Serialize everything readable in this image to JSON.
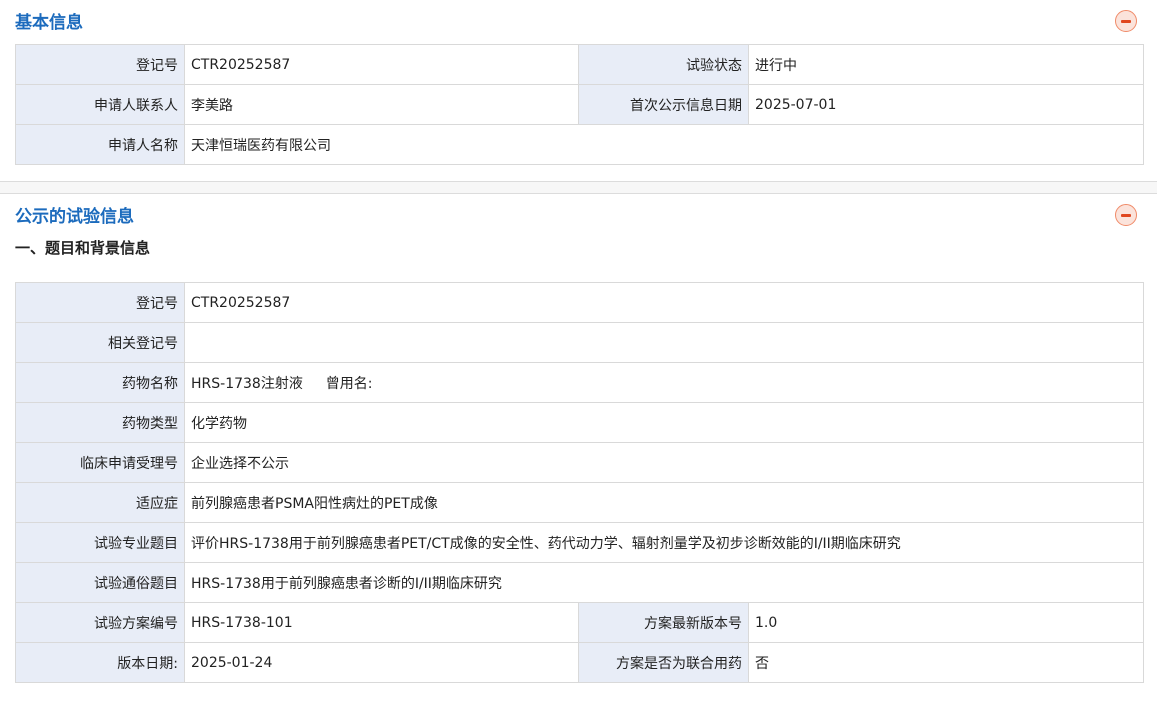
{
  "basic": {
    "title": "基本信息",
    "reg_no_label": "登记号",
    "reg_no": "CTR20252587",
    "status_label": "试验状态",
    "status": "进行中",
    "contact_label": "申请人联系人",
    "contact": "李美路",
    "first_pub_label": "首次公示信息日期",
    "first_pub": "2025-07-01",
    "applicant_label": "申请人名称",
    "applicant": "天津恒瑞医药有限公司"
  },
  "public": {
    "title": "公示的试验信息",
    "subhead": "一、题目和背景信息",
    "rows": {
      "reg_no_label": "登记号",
      "reg_no": "CTR20252587",
      "related_label": "相关登记号",
      "related": "",
      "drug_label": "药物名称",
      "drug": "HRS-1738注射液　  曾用名:",
      "drug_type_label": "药物类型",
      "drug_type": "化学药物",
      "accept_label": "临床申请受理号",
      "accept": "企业选择不公示",
      "indication_label": "适应症",
      "indication": "前列腺癌患者PSMA阳性病灶的PET成像",
      "sci_title_label": "试验专业题目",
      "sci_title": "评价HRS-1738用于前列腺癌患者PET/CT成像的安全性、药代动力学、辐射剂量学及初步诊断效能的I/II期临床研究",
      "pop_title_label": "试验通俗题目",
      "pop_title": "HRS-1738用于前列腺癌患者诊断的I/II期临床研究",
      "protocol_label": "试验方案编号",
      "protocol": "HRS-1738-101",
      "version_label": "方案最新版本号",
      "version": "1.0",
      "version_date_label": "版本日期:",
      "version_date": "2025-01-24",
      "combo_label": "方案是否为联合用药",
      "combo": "否"
    }
  }
}
